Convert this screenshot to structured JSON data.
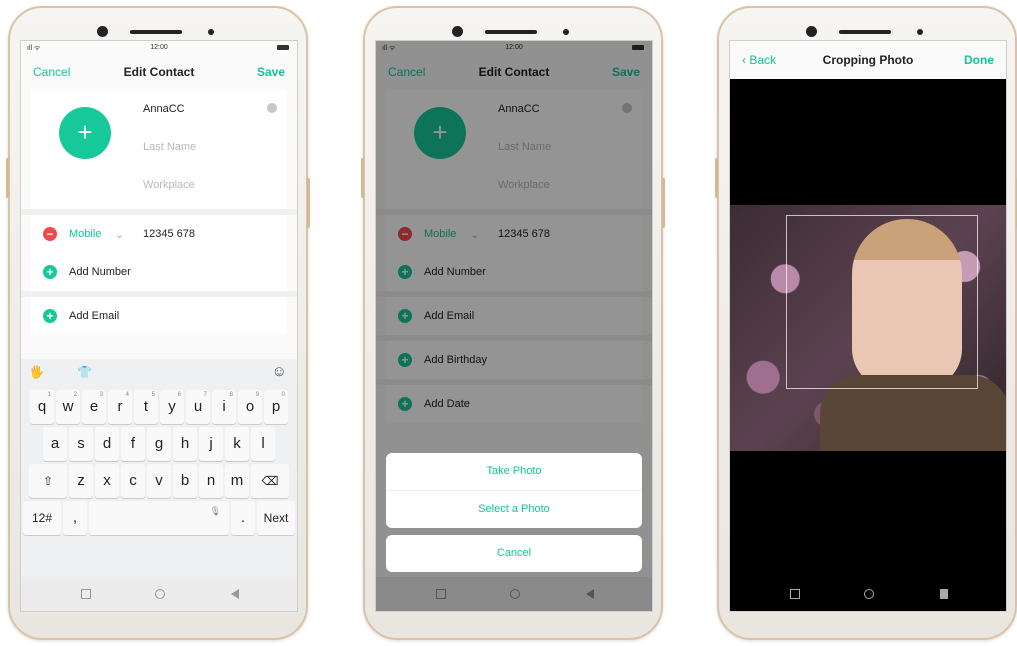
{
  "phone1": {
    "status": {
      "time": "12:00",
      "signal": "ıll ᯤ"
    },
    "nav": {
      "cancel": "Cancel",
      "title": "Edit Contact",
      "save": "Save"
    },
    "avatar_symbol": "+",
    "fields": {
      "first_name": "AnnaCC",
      "last_name_placeholder": "Last Name",
      "workplace_placeholder": "Workplace"
    },
    "phone_row": {
      "label": "Mobile",
      "caret": "⌄",
      "value": "12345 678"
    },
    "add_number": "Add Number",
    "add_email": "Add Email",
    "keyboard": {
      "toolbar_left": "🖐",
      "toolbar_mid": "👕",
      "toolbar_right": "☺",
      "row1": [
        "q",
        "w",
        "e",
        "r",
        "t",
        "y",
        "u",
        "i",
        "o",
        "p"
      ],
      "row1_sub": [
        "1",
        "2",
        "3",
        "4",
        "5",
        "6",
        "7",
        "8",
        "9",
        "0"
      ],
      "row2": [
        "a",
        "s",
        "d",
        "f",
        "g",
        "h",
        "j",
        "k",
        "l"
      ],
      "row3": [
        "z",
        "x",
        "c",
        "v",
        "b",
        "n",
        "m"
      ],
      "shift": "⇧",
      "backspace": "⌫",
      "sym": "12#",
      "comma": ",",
      "mic": "🎙",
      "period": ".",
      "next": "Next"
    }
  },
  "phone2": {
    "status": {
      "time": "12:00",
      "signal": "ıll ᯤ"
    },
    "nav": {
      "cancel": "Cancel",
      "title": "Edit Contact",
      "save": "Save"
    },
    "avatar_symbol": "+",
    "fields": {
      "first_name": "AnnaCC",
      "last_name_placeholder": "Last Name",
      "workplace_placeholder": "Workplace"
    },
    "phone_row": {
      "label": "Mobile",
      "caret": "⌄",
      "value": "12345 678"
    },
    "add_number": "Add Number",
    "add_email": "Add Email",
    "add_birthday": "Add Birthday",
    "add_date": "Add Date",
    "sheet": {
      "take_photo": "Take Photo",
      "select_photo": "Select a Photo",
      "cancel": "Cancel"
    }
  },
  "phone3": {
    "nav": {
      "back": "Back",
      "title": "Cropping Photo",
      "done": "Done"
    }
  },
  "colors": {
    "accent": "#15c39a",
    "danger": "#ef4a4a"
  }
}
